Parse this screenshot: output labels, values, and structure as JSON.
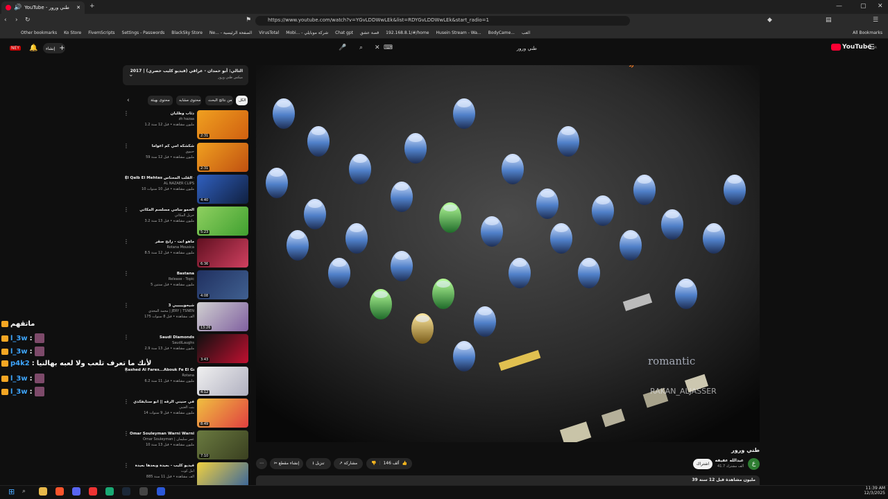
{
  "browser": {
    "tab_title": "YouTube - طني ورور",
    "url": "https://www.youtube.com/watch?v=YGvLDDWwLEk&list=RDYGvLDDWwLEk&start_radio=1",
    "bookmarks": [
      "Other bookmarks",
      "Ko Store",
      "FivemScripts",
      "Settings - Passwords",
      "BlackSky Store",
      "Ne... - الصفحة الرئيسية",
      "VirusTotal",
      "Mobi... - شركة موبايلي",
      "Chat gpt",
      "قصة عشق",
      "192.168.8.1/#/home",
      "Husein Stream - Wa...",
      "BodyCame...",
      "العب",
      "All Bookmarks"
    ]
  },
  "yt": {
    "logo": "YouTube",
    "logo_sup": "SA",
    "create_label": "إنشاء",
    "search_value": "طني ورور",
    "queue_title": "التالي: أبو حمدان - عراقي (فيديو كليب حصري) | 2017",
    "queue_sub": "ميكس طني ورور",
    "chips": [
      "الكل",
      "من نتائج البحث",
      "محتوى مشابه",
      "محتوى بهيئة"
    ],
    "recs": [
      {
        "title": "ذئاب وظليان",
        "channel": "zh hazaa",
        "meta": "1.2 مليون مشاهدة • قبل 12 سنة",
        "dur": "2:31"
      },
      {
        "title": "شكشكه امي كم اعواما",
        "channel": "حنيوي",
        "meta": "59 مليون مشاهدة • قبل 12 سنة",
        "dur": "2:31"
      },
      {
        "title": "El Qalb El Mehtas بلبل - القلب المحتاس",
        "channel": "AL NAZAER CLIPS",
        "meta": "10 مليون مشاهدة • قبل 10 سنوات",
        "dur": "4:40"
      },
      {
        "title": "الحمو سامي مسلسم المكاتي",
        "channel": "حزيل المكاتي",
        "meta": "3.2 مليون مشاهدة • قبل 13 سنة",
        "dur": "5:23"
      },
      {
        "title": "ماهو انت - رابح صقر",
        "channel": "Rotana Mousica",
        "meta": "8.5 مليون مشاهدة • قبل 12 سنة",
        "dur": "6:36"
      },
      {
        "title": "Bastana",
        "channel": "Release - Topic",
        "meta": "5 مليون مشاهدة • قبل سنتين",
        "dur": "4:08"
      },
      {
        "title": "شيحويييييي 3",
        "channel": "محمد المحدي | JERY | TSNEN",
        "meta": "175 ألف مشاهدة • قبل 8 سنوات",
        "dur": "13:26"
      },
      {
        "title": "Saudi Diamonds",
        "channel": "SaudiLaughs",
        "meta": "2.9 مليون مشاهدة • قبل 13 سنة",
        "dur": "3:43"
      },
      {
        "title": "Rashed Al Fares...Abouk Fe El Gannah | راشد الفارس...أبوك في الجنة",
        "channel": "Rotana",
        "meta": "6.2 مليون مشاهدة • قبل 11 سنة",
        "dur": "4:12"
      },
      {
        "title": "في حنيني الرقه || ابو ستايفكذي",
        "channel": "بنت العنبي",
        "meta": "14 مليون مشاهدة • قبل 9 سنوات",
        "dur": "8:49"
      },
      {
        "title": "Omar Souleyman Warni Warni",
        "channel": "Omar Souleyman | عمر سليمان",
        "meta": "10 مليون مشاهدة • قبل 13 سنة",
        "dur": "7:10"
      },
      {
        "title": "فيديو كليب - بعيدة وبعدها بعيدة",
        "channel": "أمل كوت",
        "meta": "885 ألف مشاهدة • قبل 11 سنة",
        "dur": "4:36"
      }
    ],
    "video_title": "طني ورور",
    "watermark": "romantic",
    "watermark2": "RAKAN_ALJASSER",
    "channel_name": "عبدالله عفيفه",
    "subs": "41.7 ألف مشترك",
    "subscribe_label": "اشتراك",
    "avatar_letter": "ع",
    "likes": "146 ألف",
    "share_label": "مشاركة",
    "download_label": "تنزيل",
    "clip_label": "إنشاء مقطع",
    "views_line": "39 مليون مشاهدة قبل 12 سنة"
  },
  "chat": [
    {
      "user": "",
      "text": "ماتقهم"
    },
    {
      "user": "l_3w",
      "text": ""
    },
    {
      "user": "l_3w",
      "text": ""
    },
    {
      "user": "p4k2",
      "text": "لأنك ما تعرف تلعب ولا لعبه بهالنيا"
    },
    {
      "user": "l_3w",
      "text": ""
    },
    {
      "user": "l_3w",
      "text": ""
    }
  ],
  "taskbar": {
    "time": "11:39 AM",
    "date": "12/3/2025"
  },
  "colors": {
    "yt_red": "#ff0033",
    "bg": "#0f0f0f",
    "chat_user": "#3ea6ff"
  }
}
